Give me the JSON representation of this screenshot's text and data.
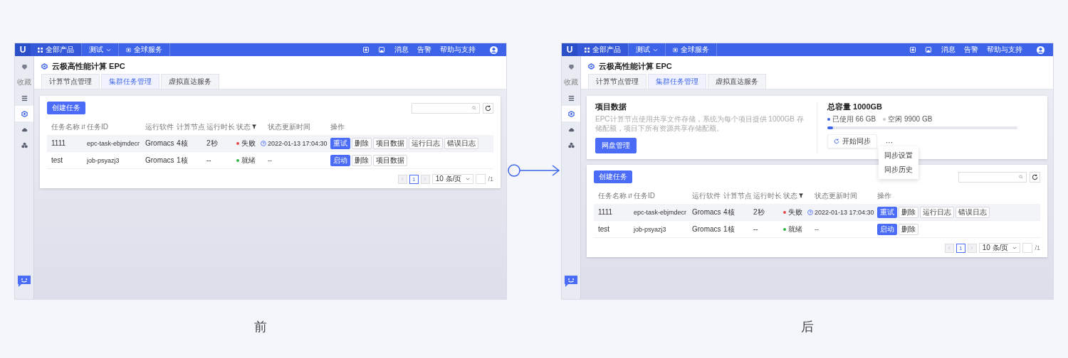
{
  "screens": [
    {
      "caption": "前",
      "topbar": {
        "logo": "U",
        "menu_items": [
          {
            "kind": "grid",
            "label": "全部产品",
            "selected": true
          },
          {
            "kind": "dropdown",
            "label": "测试",
            "selected": false
          },
          {
            "kind": "globe",
            "label": "全球服务",
            "selected": false
          }
        ],
        "links": [
          "消息",
          "告警",
          "帮助与支持"
        ]
      },
      "sidebar": {
        "items": [
          {
            "kind": "chip",
            "selected": false
          },
          {
            "kind": "text",
            "label": "收藏",
            "selected": false
          },
          {
            "kind": "list",
            "selected": false
          },
          {
            "kind": "cube",
            "selected": true
          },
          {
            "kind": "cloud",
            "selected": false
          },
          {
            "kind": "cluster",
            "selected": false
          }
        ]
      },
      "title": "云极高性能计算 EPC",
      "tabs": [
        {
          "label": "计算节点管理",
          "selected": false
        },
        {
          "label": "集群任务管理",
          "selected": true
        },
        {
          "label": "虚拟直达服务",
          "selected": false
        }
      ],
      "table": {
        "create_button": "创建任务",
        "columns": [
          {
            "label": "任务名称",
            "kind": "sortable"
          },
          {
            "label": "任务ID",
            "kind": "plain"
          },
          {
            "label": "运行软件",
            "kind": "plain"
          },
          {
            "label": "计算节点",
            "kind": "plain"
          },
          {
            "label": "运行时长",
            "kind": "plain"
          },
          {
            "label": "状态",
            "kind": "filterable"
          },
          {
            "label": "状态更新时间",
            "kind": "plain"
          },
          {
            "label": "操作",
            "kind": "plain"
          }
        ],
        "rows": [
          {
            "highlighted": true,
            "cells": [
              "1111",
              "epc-task-ebjmdecr",
              "Gromacs",
              "4核",
              "2秒"
            ],
            "status": {
              "label": "失败",
              "color": "#e5484d",
              "help": true
            },
            "time": "2022-01-13 17:04:30",
            "actions": [
              {
                "label": "重试",
                "primary": true
              },
              {
                "label": "删除",
                "primary": false
              },
              {
                "label": "项目数据",
                "primary": false
              },
              {
                "label": "运行日志",
                "primary": false
              },
              {
                "label": "错误日志",
                "primary": false
              }
            ]
          },
          {
            "highlighted": false,
            "cells": [
              "test",
              "job-psyazj3",
              "Gromacs",
              "1核",
              "--"
            ],
            "status": {
              "label": "就绪",
              "color": "#2fb344",
              "help": false
            },
            "time": "--",
            "actions": [
              {
                "label": "启动",
                "primary": true
              },
              {
                "label": "删除",
                "primary": false
              },
              {
                "label": "项目数据",
                "primary": false
              }
            ]
          }
        ],
        "pagination": {
          "pages": [
            {
              "label": "1",
              "selected": true
            }
          ],
          "page_size": "10 条/页",
          "total_pages": "/1"
        }
      }
    },
    {
      "caption": "后",
      "topbar": {
        "logo": "U",
        "menu_items": [
          {
            "kind": "grid",
            "label": "全部产品",
            "selected": true
          },
          {
            "kind": "dropdown",
            "label": "测试",
            "selected": false
          },
          {
            "kind": "globe",
            "label": "全球服务",
            "selected": false
          }
        ],
        "links": [
          "消息",
          "告警",
          "帮助与支持"
        ]
      },
      "sidebar": {
        "items": [
          {
            "kind": "chip",
            "selected": false
          },
          {
            "kind": "text",
            "label": "收藏",
            "selected": false
          },
          {
            "kind": "list",
            "selected": false
          },
          {
            "kind": "cube",
            "selected": true
          },
          {
            "kind": "cloud",
            "selected": false
          },
          {
            "kind": "cluster",
            "selected": false
          }
        ]
      },
      "title": "云极高性能计算 EPC",
      "tabs": [
        {
          "label": "计算节点管理",
          "selected": false
        },
        {
          "label": "集群任务管理",
          "selected": true
        },
        {
          "label": "虚拟直达服务",
          "selected": false
        }
      ],
      "storage": {
        "title": "项目数据",
        "description": "EPC计算节点使用共享文件存储，系统为每个项目提供 1000GB 存储配额，项目下所有资源共享存储配额。",
        "button": "网盘管理",
        "capacity": "总容量 1000GB",
        "used": "已使用 66 GB",
        "free": "空闲 9900 GB",
        "level": 0.03,
        "sync_button": "开始同步",
        "more": "···",
        "menu": [
          "同步设置",
          "同步历史"
        ]
      },
      "table": {
        "create_button": "创建任务",
        "columns": [
          {
            "label": "任务名称",
            "kind": "sortable"
          },
          {
            "label": "任务ID",
            "kind": "plain"
          },
          {
            "label": "运行软件",
            "kind": "plain"
          },
          {
            "label": "计算节点",
            "kind": "plain"
          },
          {
            "label": "运行时长",
            "kind": "plain"
          },
          {
            "label": "状态",
            "kind": "filterable"
          },
          {
            "label": "状态更新时间",
            "kind": "plain"
          },
          {
            "label": "操作",
            "kind": "plain"
          }
        ],
        "rows": [
          {
            "highlighted": true,
            "cells": [
              "1111",
              "epc-task-ebjmdecr",
              "Gromacs",
              "4核",
              "2秒"
            ],
            "status": {
              "label": "失败",
              "color": "#e5484d",
              "help": true
            },
            "time": "2022-01-13 17:04:30",
            "actions": [
              {
                "label": "重试",
                "primary": true
              },
              {
                "label": "删除",
                "primary": false
              },
              {
                "label": "运行日志",
                "primary": false
              },
              {
                "label": "错误日志",
                "primary": false
              }
            ]
          },
          {
            "highlighted": false,
            "cells": [
              "test",
              "job-psyazj3",
              "Gromacs",
              "1核",
              "--"
            ],
            "status": {
              "label": "就绪",
              "color": "#2fb344",
              "help": false
            },
            "time": "--",
            "actions": [
              {
                "label": "启动",
                "primary": true
              },
              {
                "label": "删除",
                "primary": false
              }
            ]
          }
        ],
        "pagination": {
          "pages": [
            {
              "label": "1",
              "selected": true
            }
          ],
          "page_size": "10 条/页",
          "total_pages": "/1"
        }
      }
    }
  ]
}
